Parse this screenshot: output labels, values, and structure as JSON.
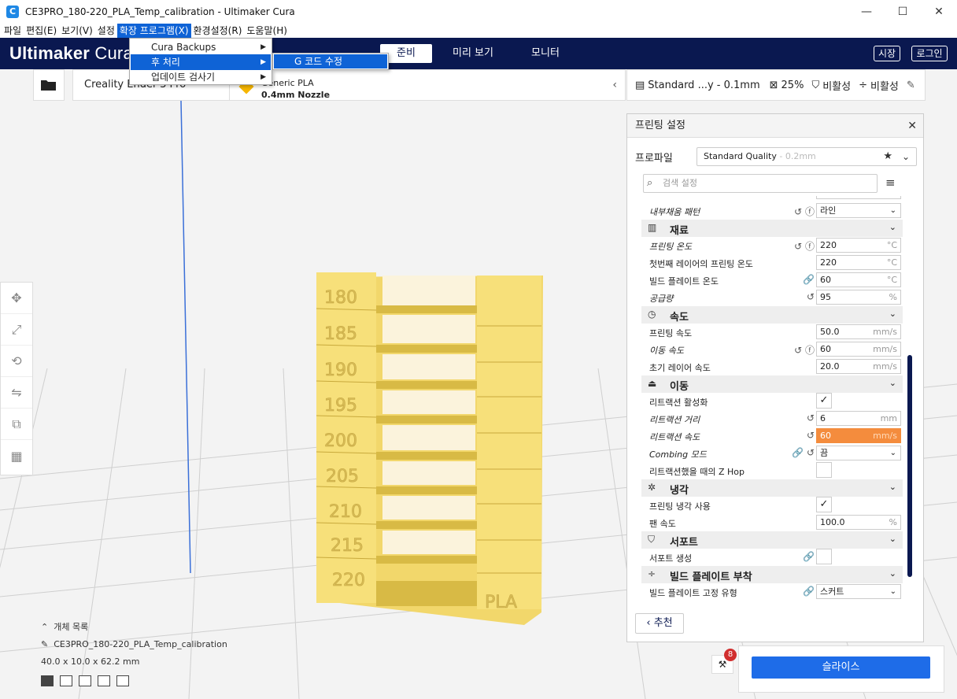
{
  "window": {
    "title": "CE3PRO_180-220_PLA_Temp_calibration - Ultimaker Cura",
    "icon": "C",
    "minimize": "—",
    "maximize": "☐",
    "close": "✕"
  },
  "menubar": [
    {
      "label": "파일"
    },
    {
      "label": "편집(E)"
    },
    {
      "label": "보기(V)"
    },
    {
      "label": "설정"
    },
    {
      "label": "확장 프로그램(X)"
    },
    {
      "label": "환경설정(R)"
    },
    {
      "label": "도움말(H)"
    }
  ],
  "dropdown": {
    "items": [
      {
        "label": "Cura Backups"
      },
      {
        "label": "후 처리"
      },
      {
        "label": "업데이트 검사기"
      }
    ],
    "submenu_item": "G 코드 수정"
  },
  "header": {
    "logo_bold": "Ultimaker",
    "logo_light": " Cura",
    "tabs": [
      {
        "label": "준비"
      },
      {
        "label": "미리 보기"
      },
      {
        "label": "모니터"
      }
    ],
    "marketplace": "시장",
    "login": "로그인"
  },
  "printer": {
    "name": "Creality Ender-3 Pro"
  },
  "material": {
    "name": "Generic PLA",
    "nozzle": "0.4mm Nozzle"
  },
  "profile_strip": {
    "profile": "Standard ...y - 0.1mm",
    "infill": "25%",
    "support": "비활성",
    "adhesion": "비활성"
  },
  "panel": {
    "title": "프린팅 설정",
    "profile_label": "프로파일",
    "profile_value": "Standard Quality",
    "profile_suffix": " - 0.2mm",
    "search_placeholder": "검색 설정",
    "recommend": "추천",
    "rows": [
      {
        "label": "내부채움 패턴",
        "italic": true,
        "icons": "↺ ⓕ",
        "type": "select",
        "value": "라인"
      },
      {
        "cat": true,
        "label": "재료",
        "icon": "▥"
      },
      {
        "label": "프린팅 온도",
        "italic": true,
        "icons": "↺ ⓕ",
        "type": "field",
        "value": "220",
        "unit": "°C"
      },
      {
        "label": "첫번째 레이어의 프린팅 온도",
        "type": "field",
        "value": "220",
        "unit": "°C"
      },
      {
        "label": "빌드 플레이트 온도",
        "icons": "🔗",
        "type": "field",
        "value": "60",
        "unit": "°C"
      },
      {
        "label": "공급량",
        "italic": true,
        "icons": "↺",
        "type": "field",
        "value": "95",
        "unit": "%"
      },
      {
        "cat": true,
        "label": "속도",
        "icon": "◷"
      },
      {
        "label": "프린팅 속도",
        "type": "field",
        "value": "50.0",
        "unit": "mm/s"
      },
      {
        "label": "이동 속도",
        "italic": true,
        "icons": "↺ ⓕ",
        "type": "field",
        "value": "60",
        "unit": "mm/s"
      },
      {
        "label": "초기 레이어 속도",
        "type": "field",
        "value": "20.0",
        "unit": "mm/s"
      },
      {
        "cat": true,
        "label": "이동",
        "icon": "⏏"
      },
      {
        "label": "리트랙션 활성화",
        "type": "check",
        "value": "✓"
      },
      {
        "label": "리트랙션 거리",
        "italic": true,
        "icons": "↺",
        "type": "field",
        "value": "6",
        "unit": "mm"
      },
      {
        "label": "리트랙션 속도",
        "italic": true,
        "icons": "↺",
        "type": "field",
        "value": "60",
        "unit": "mm/s",
        "orange": true
      },
      {
        "label": "Combing 모드",
        "italic": true,
        "icons": "🔗 ↺",
        "type": "select",
        "value": "끔"
      },
      {
        "label": "리트랙션했을 때의 Z Hop",
        "type": "check",
        "value": ""
      },
      {
        "cat": true,
        "label": "냉각",
        "icon": "✲"
      },
      {
        "label": "프린팅 냉각 사용",
        "type": "check",
        "value": "✓"
      },
      {
        "label": "팬 속도",
        "type": "field",
        "value": "100.0",
        "unit": "%"
      },
      {
        "cat": true,
        "label": "서포트",
        "icon": "⛉"
      },
      {
        "label": "서포트 생성",
        "icons": "🔗",
        "type": "check",
        "value": ""
      },
      {
        "cat": true,
        "label": "빌드 플레이트 부착",
        "icon": "÷"
      },
      {
        "label": "빌드 플레이트 고정 유형",
        "icons": "🔗",
        "type": "select",
        "value": "스커트"
      }
    ]
  },
  "object": {
    "list_toggle": "개체 목록",
    "file": "CE3PRO_180-220_PLA_Temp_calibration",
    "dims": "40.0 x 10.0 x 62.2 mm"
  },
  "model_labels": [
    "180",
    "185",
    "190",
    "195",
    "200",
    "205",
    "210",
    "215",
    "220",
    "PLA"
  ],
  "slice": {
    "label": "슬라이스",
    "badge": "8"
  },
  "colors": {
    "header": "#0a1850",
    "accent": "#0f63d6",
    "model": "#f7e07a",
    "highlight": "#f48c3d",
    "slice": "#1e6ce8"
  }
}
